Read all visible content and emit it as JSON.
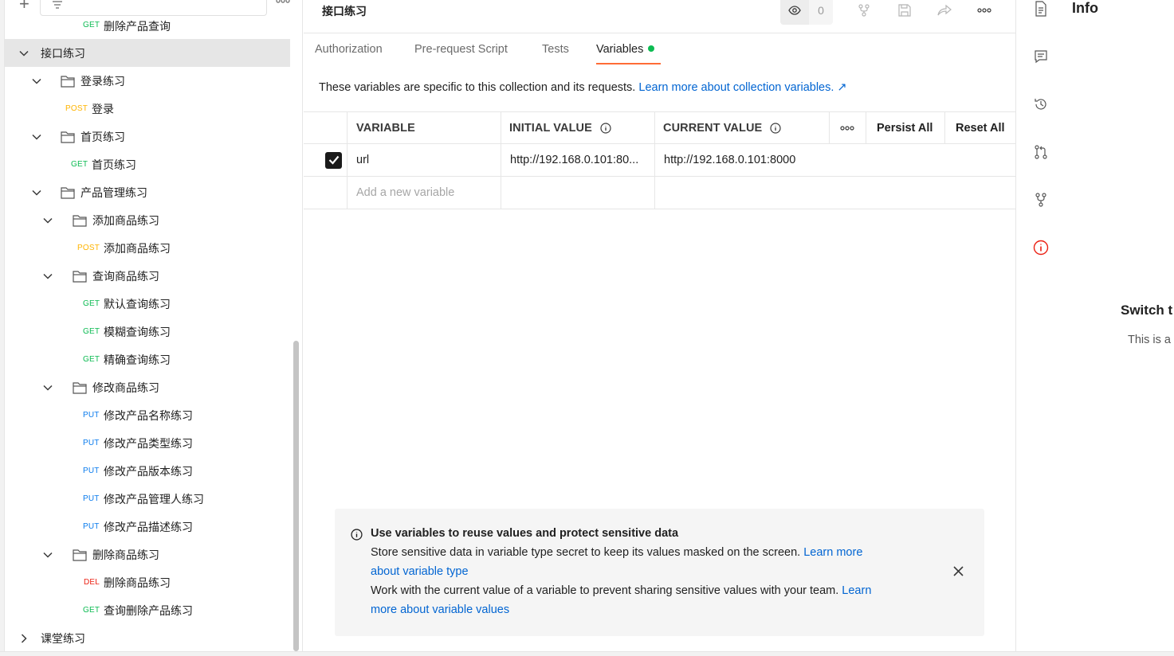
{
  "sidebar": {
    "items": [
      {
        "kind": "request",
        "method": "GET",
        "label": "删除产品查询",
        "depth": 4,
        "cut": true
      },
      {
        "kind": "collection",
        "label": "接口练习",
        "depth": 0,
        "expanded": true,
        "selected": true
      },
      {
        "kind": "folder",
        "label": "登录练习",
        "depth": 1,
        "expanded": true
      },
      {
        "kind": "request",
        "method": "POST",
        "label": "登录",
        "depth": 2
      },
      {
        "kind": "folder",
        "label": "首页练习",
        "depth": 1,
        "expanded": true
      },
      {
        "kind": "request",
        "method": "GET",
        "label": "首页练习",
        "depth": 2
      },
      {
        "kind": "folder",
        "label": "产品管理练习",
        "depth": 1,
        "expanded": true
      },
      {
        "kind": "folder",
        "label": "添加商品练习",
        "depth": 2,
        "expanded": true
      },
      {
        "kind": "request",
        "method": "POST",
        "label": "添加商品练习",
        "depth": 3
      },
      {
        "kind": "folder",
        "label": "查询商品练习",
        "depth": 2,
        "expanded": true
      },
      {
        "kind": "request",
        "method": "GET",
        "label": "默认查询练习",
        "depth": 3
      },
      {
        "kind": "request",
        "method": "GET",
        "label": "模糊查询练习",
        "depth": 3
      },
      {
        "kind": "request",
        "method": "GET",
        "label": "精确查询练习",
        "depth": 3
      },
      {
        "kind": "folder",
        "label": "修改商品练习",
        "depth": 2,
        "expanded": true
      },
      {
        "kind": "request",
        "method": "PUT",
        "label": "修改产品名称练习",
        "depth": 3
      },
      {
        "kind": "request",
        "method": "PUT",
        "label": "修改产品类型练习",
        "depth": 3
      },
      {
        "kind": "request",
        "method": "PUT",
        "label": "修改产品版本练习",
        "depth": 3
      },
      {
        "kind": "request",
        "method": "PUT",
        "label": "修改产品管理人练习",
        "depth": 3
      },
      {
        "kind": "request",
        "method": "PUT",
        "label": "修改产品描述练习",
        "depth": 3
      },
      {
        "kind": "folder",
        "label": "删除商品练习",
        "depth": 2,
        "expanded": true
      },
      {
        "kind": "request",
        "method": "DEL",
        "label": "删除商品练习",
        "depth": 3
      },
      {
        "kind": "request",
        "method": "GET",
        "label": "查询删除产品练习",
        "depth": 3
      },
      {
        "kind": "collection",
        "label": "课堂练习",
        "depth": 0,
        "expanded": false
      }
    ]
  },
  "header": {
    "title": "接口练习",
    "watch_count": "0"
  },
  "tabs": [
    {
      "label": "Authorization"
    },
    {
      "label": "Pre-request Script"
    },
    {
      "label": "Tests"
    },
    {
      "label": "Variables",
      "active": true
    }
  ],
  "description": {
    "text": "These variables are specific to this collection and its requests. ",
    "link": "Learn more about collection variables. ↗"
  },
  "table": {
    "headers": {
      "variable": "VARIABLE",
      "initial": "INITIAL VALUE",
      "current": "CURRENT VALUE",
      "persist": "Persist All",
      "reset": "Reset All"
    },
    "rows": [
      {
        "checked": true,
        "variable": "url",
        "initial": "http://192.168.0.101:80...",
        "current": "http://192.168.0.101:8000"
      }
    ],
    "new_placeholder": "Add a new variable"
  },
  "banner": {
    "title": "Use variables to reuse values and protect sensitive data",
    "line1_text": "Store sensitive data in variable type secret to keep its values masked on the screen. ",
    "line1_link_a": "Learn more",
    "line1_link_b": "about variable type",
    "line2_text": "Work with the current value of a variable to prevent sharing sensitive values with your team. ",
    "line2_link_a": "Learn",
    "line2_link_b": "more about variable values"
  },
  "right_panel": {
    "title": "Info",
    "switch_text": "Switch t",
    "this_is_text": "This is a"
  },
  "colors": {
    "accent": "#ff6c37",
    "link": "#0265d2",
    "get": "#0cbb52",
    "post": "#ffb400",
    "put": "#097bed",
    "del": "#eb2013"
  }
}
